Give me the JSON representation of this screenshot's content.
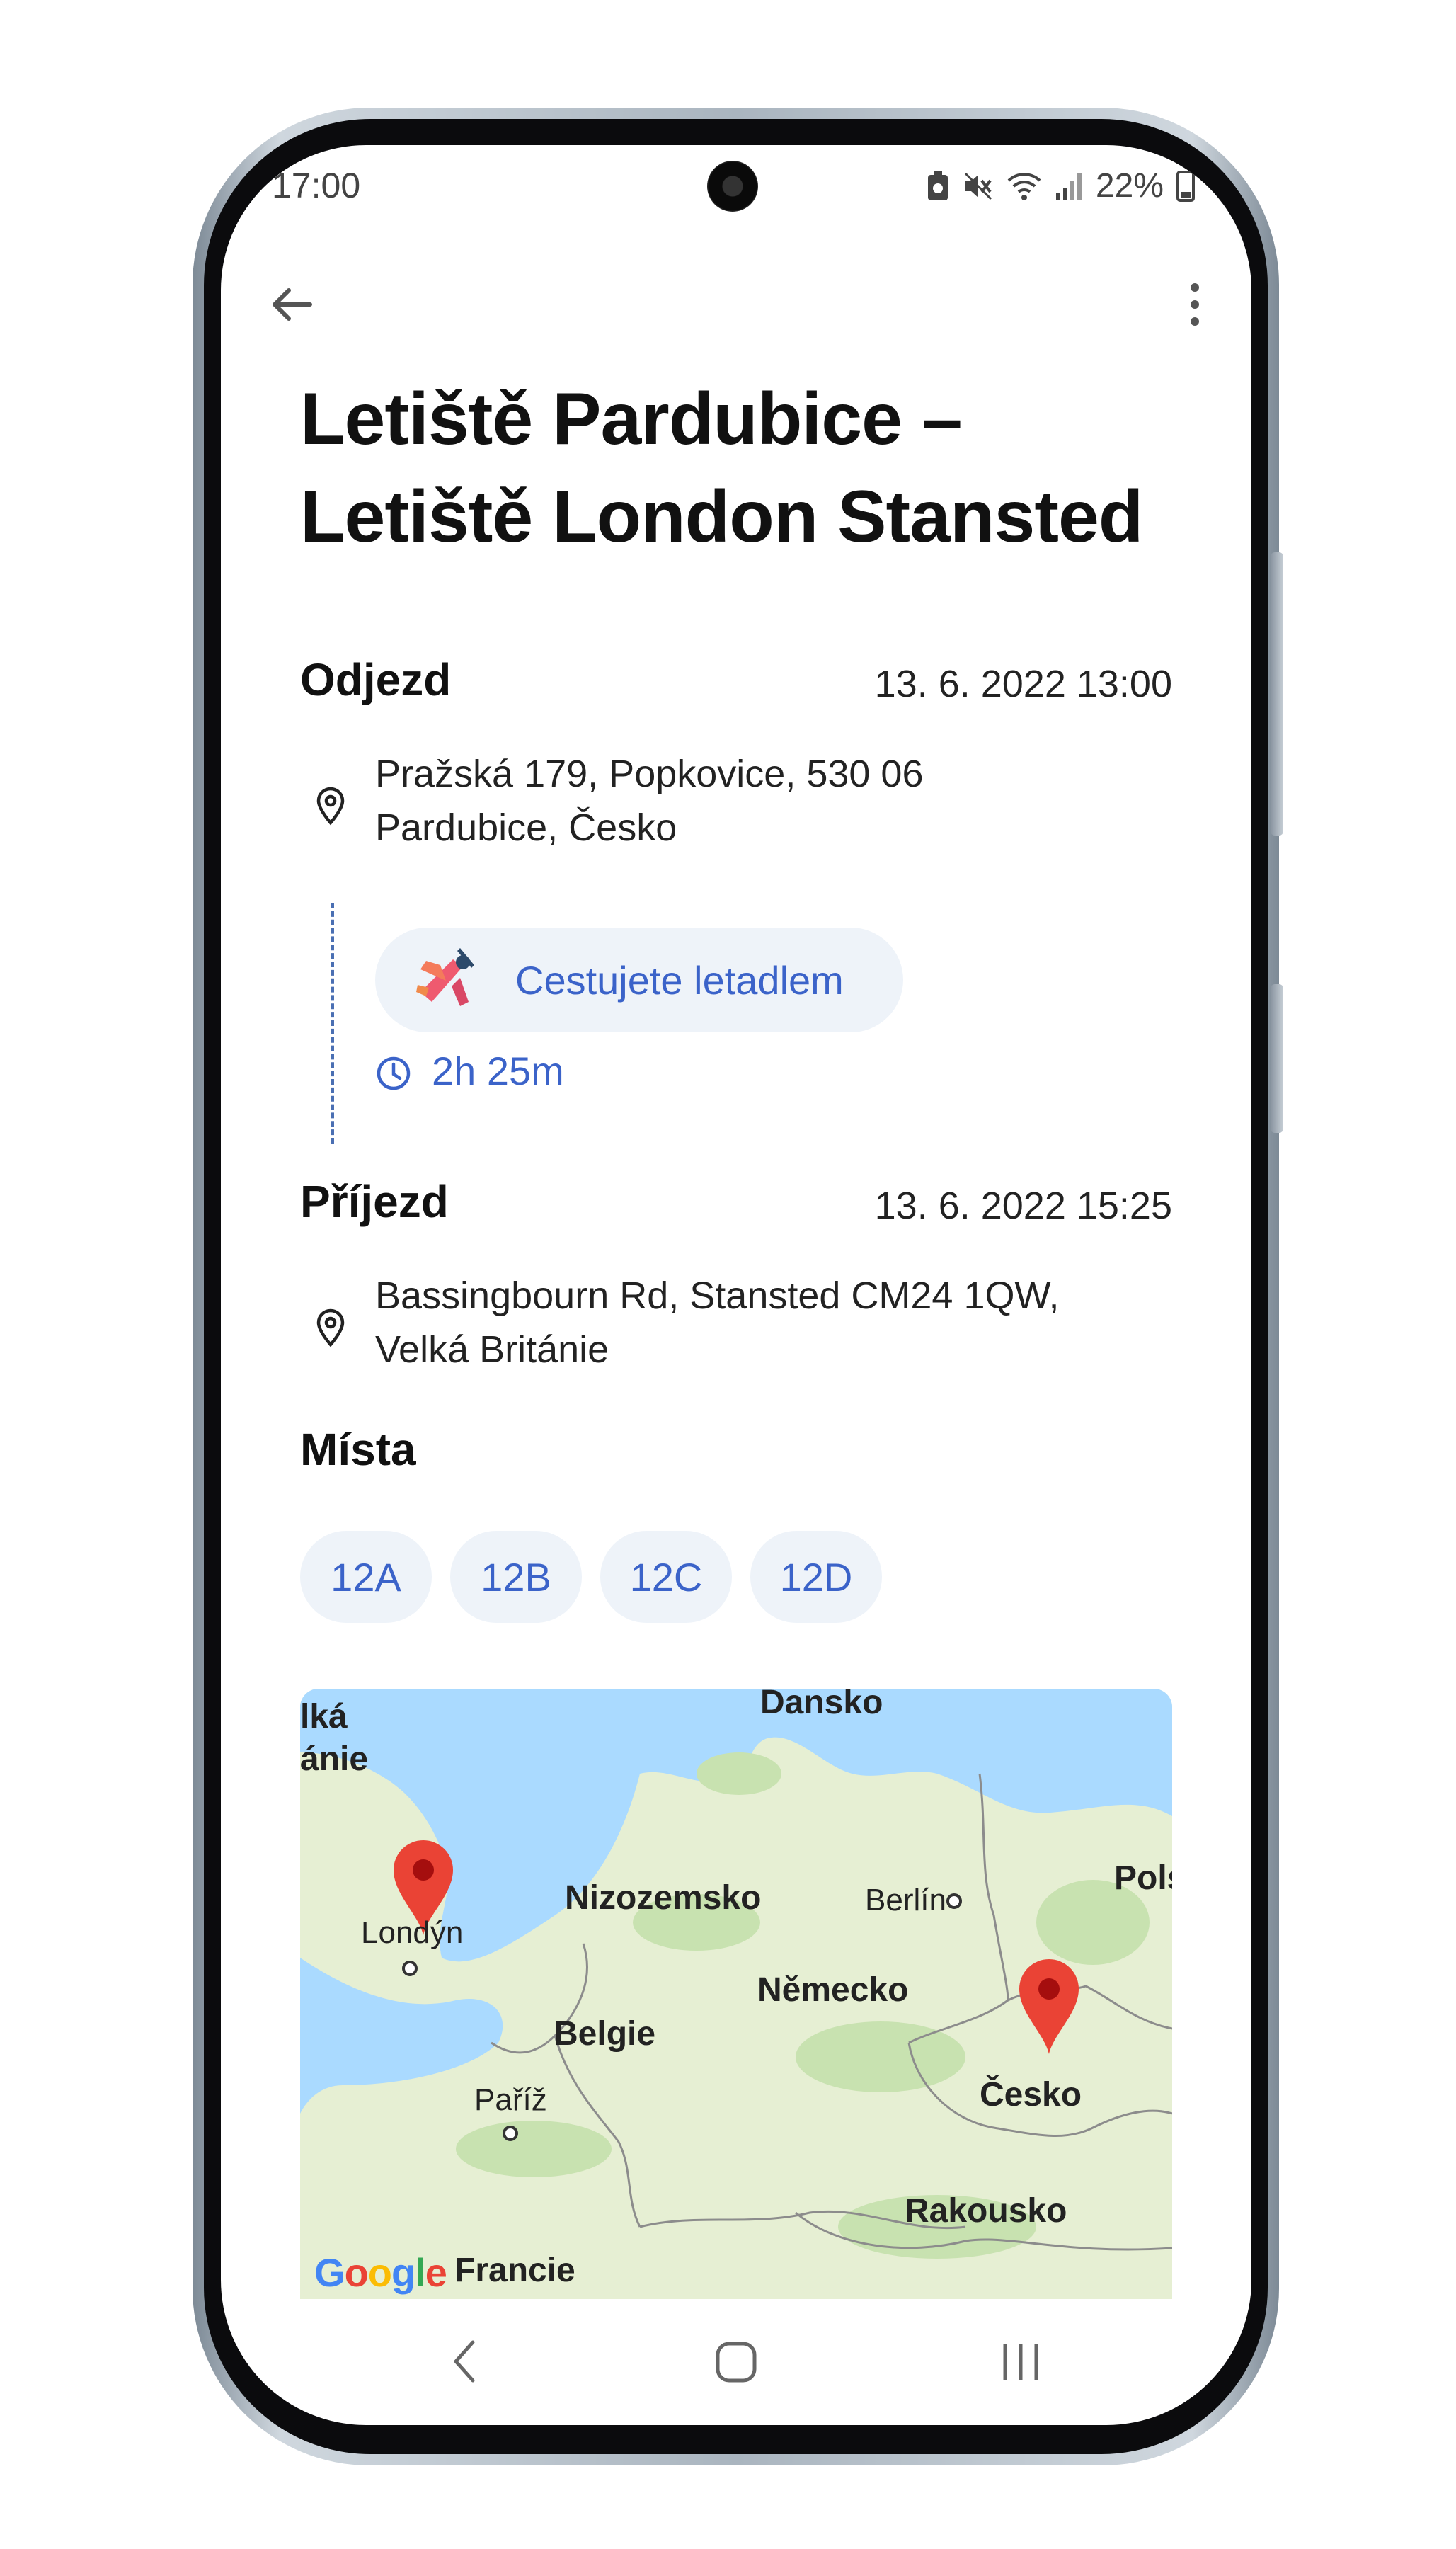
{
  "status_bar": {
    "time": "17:00",
    "battery": "22%"
  },
  "trip": {
    "title": "Letiště Pardubice – Letiště London Stansted",
    "departure": {
      "label": "Odjezd",
      "datetime": "13. 6. 2022 13:00",
      "address_line1": "Pražská 179, Popkovice, 530 06",
      "address_line2": "Pardubice, Česko"
    },
    "travel": {
      "mode_label": "Cestujete letadlem",
      "duration": "2h 25m"
    },
    "arrival": {
      "label": "Příjezd",
      "datetime": "13. 6. 2022 15:25",
      "address_line1": "Bassingbourn Rd, Stansted CM24 1QW,",
      "address_line2": "Velká Británie"
    },
    "seats": {
      "label": "Místa",
      "items": [
        "12A",
        "12B",
        "12C",
        "12D"
      ]
    }
  },
  "map": {
    "labels": {
      "dansko": "Dansko",
      "velka": "lká",
      "britanie": "ánie",
      "nizozemsko": "Nizozemsko",
      "berlin": "Berlín",
      "polsko": "Pols",
      "londyn": "Londýn",
      "nemecko": "Německo",
      "belgie": "Belgie",
      "pariz": "Paříž",
      "cesko": "Česko",
      "rakousko": "Rakousko",
      "francie": "Francie"
    },
    "logo": "Google",
    "colors": {
      "water": "#aadaff",
      "land": "#e6efd3",
      "forest": "#c8e2b0",
      "pin": "#ea4335"
    }
  },
  "colors": {
    "accent": "#3b63c9",
    "chip_bg": "#eef3f9"
  }
}
